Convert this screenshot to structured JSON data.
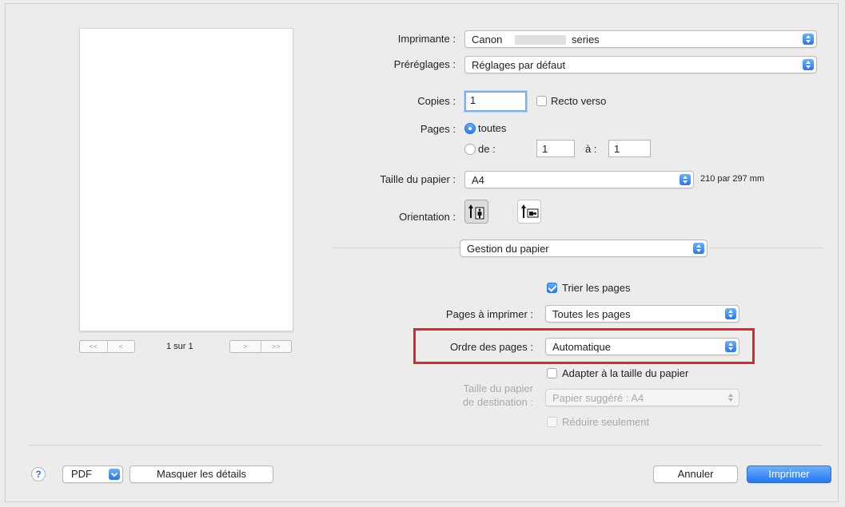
{
  "preview": {
    "page_indicator": "1 sur 1",
    "nav_first": "<<",
    "nav_prev": "<",
    "nav_next": ">",
    "nav_last": ">>"
  },
  "printer": {
    "label": "Imprimante :",
    "value_prefix": "Canon",
    "value_suffix": "series"
  },
  "presets": {
    "label": "Préréglages :",
    "value": "Réglages par défaut"
  },
  "copies": {
    "label": "Copies :",
    "value": "1",
    "duplex_label": "Recto verso",
    "duplex_checked": false
  },
  "pages": {
    "label": "Pages :",
    "all_label": "toutes",
    "range_label": "de :",
    "from_value": "1",
    "to_label": "à :",
    "to_value": "1"
  },
  "paper_size": {
    "label": "Taille du papier :",
    "value": "A4",
    "dimensions": "210 par 297 mm"
  },
  "orientation": {
    "label": "Orientation :",
    "selected": "portrait",
    "portrait_icon": "portrait-icon",
    "landscape_icon": "landscape-icon"
  },
  "section": {
    "value": "Gestion du papier"
  },
  "paper_handling": {
    "collate_label": "Trier les pages",
    "collate_checked": true,
    "pages_to_print_label": "Pages à imprimer :",
    "pages_to_print_value": "Toutes les pages",
    "page_order_label": "Ordre des pages :",
    "page_order_value": "Automatique",
    "scale_to_fit_label": "Adapter à la taille du papier",
    "scale_to_fit_checked": false,
    "dest_size_label_1": "Taille du papier",
    "dest_size_label_2": "de destination :",
    "dest_size_value": "Papier suggéré : A4",
    "scale_down_label": "Réduire seulement"
  },
  "footer": {
    "help": "?",
    "pdf": "PDF",
    "hide_details": "Masquer les détails",
    "cancel": "Annuler",
    "print": "Imprimer"
  },
  "colors": {
    "accent": "#2677f0",
    "highlight": "#e0262b"
  }
}
